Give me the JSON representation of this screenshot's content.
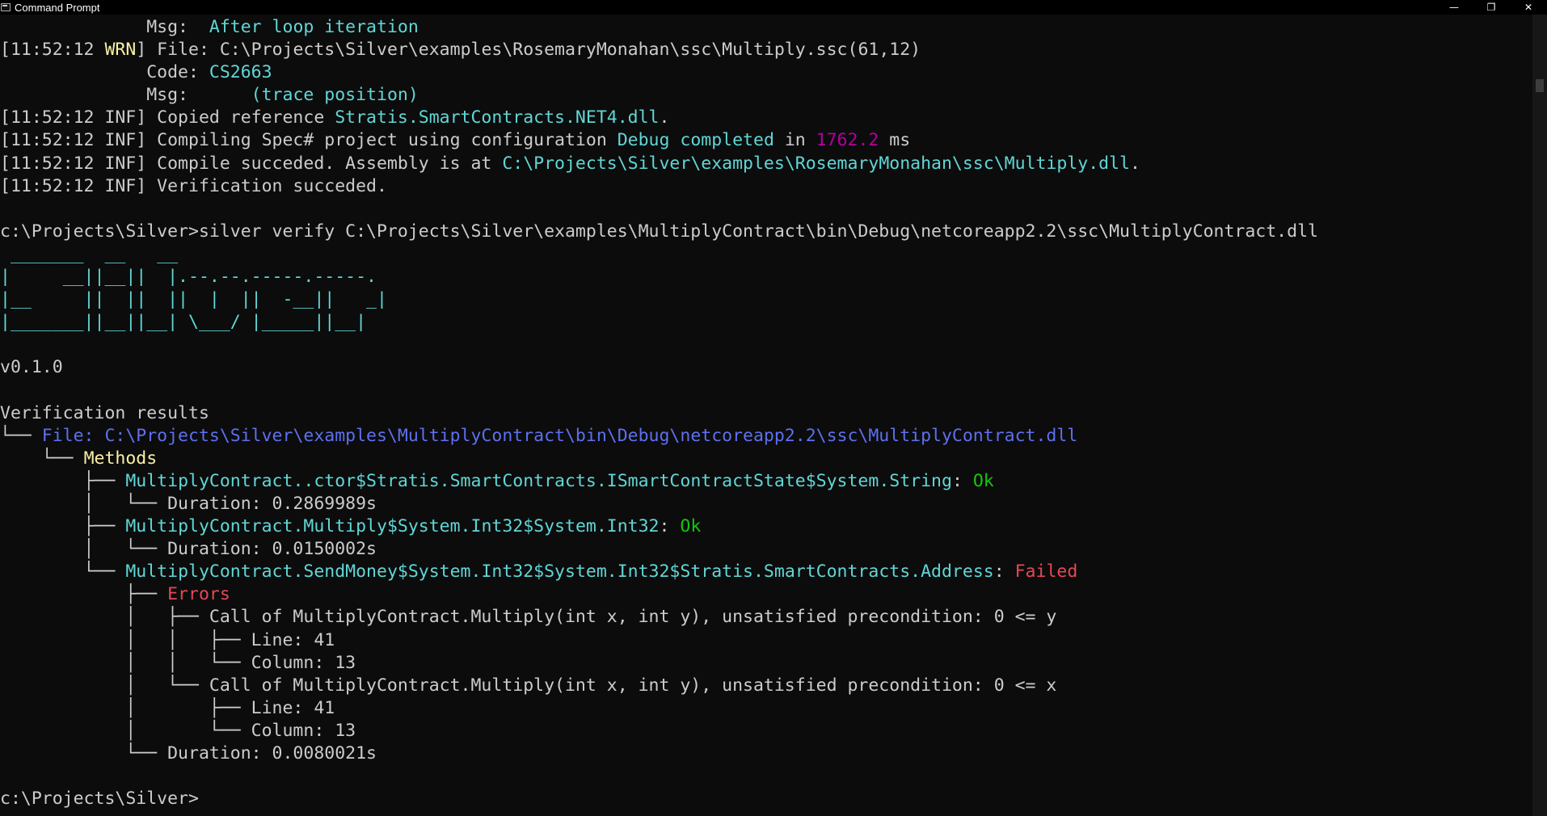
{
  "window": {
    "title": "Command Prompt",
    "minimize_glyph": "—",
    "maximize_glyph": "❐",
    "close_glyph": "✕"
  },
  "colors": {
    "background": "#0c0c0c",
    "text": "#cccccc",
    "cyan": "#61d6d6",
    "yellow": "#f9f1a5",
    "magenta": "#b4009e",
    "blue": "#5d70f0",
    "green": "#16c60c",
    "red": "#e74856"
  },
  "lines": [
    [
      [
        "c-white",
        "              Msg:  "
      ],
      [
        "c-cyan",
        "After loop iteration"
      ]
    ],
    [
      [
        "c-white",
        "[11:52:12 "
      ],
      [
        "c-warn",
        "WRN"
      ],
      [
        "c-white",
        "] File: C:\\Projects\\Silver\\examples\\RosemaryMonahan\\ssc\\Multiply.ssc(61,12)"
      ]
    ],
    [
      [
        "c-white",
        "              Code: "
      ],
      [
        "c-cyan",
        "CS2663"
      ]
    ],
    [
      [
        "c-white",
        "              Msg:      "
      ],
      [
        "c-cyan",
        "(trace position)"
      ]
    ],
    [
      [
        "c-white",
        "[11:52:12 INF] Copied reference "
      ],
      [
        "c-cyan",
        "Stratis.SmartContracts.NET4.dll"
      ],
      [
        "c-white",
        "."
      ]
    ],
    [
      [
        "c-white",
        "[11:52:12 INF] Compiling Spec# project using configuration "
      ],
      [
        "c-cyan",
        "Debug"
      ],
      [
        "c-white",
        " "
      ],
      [
        "c-cyan",
        "completed"
      ],
      [
        "c-white",
        " in "
      ],
      [
        "c-mag",
        "1762.2"
      ],
      [
        "c-white",
        " ms"
      ]
    ],
    [
      [
        "c-white",
        "[11:52:12 INF] Compile succeded. Assembly is at "
      ],
      [
        "c-cyan",
        "C:\\Projects\\Silver\\examples\\RosemaryMonahan\\ssc\\Multiply.dll"
      ],
      [
        "c-white",
        "."
      ]
    ],
    [
      [
        "c-white",
        "[11:52:12 INF] Verification succeded."
      ]
    ],
    [
      [
        "c-white",
        ""
      ]
    ],
    [
      [
        "c-white",
        "c:\\Projects\\Silver>silver verify C:\\Projects\\Silver\\examples\\MultiplyContract\\bin\\Debug\\netcoreapp2.2\\ssc\\MultiplyContract.dll"
      ]
    ],
    [
      [
        "c-cyan",
        " _______  __   __"
      ]
    ],
    [
      [
        "c-cyan",
        "|     __||__||  |.--.--.-----.-----."
      ]
    ],
    [
      [
        "c-cyan",
        "|__     ||  ||  ||  |  ||  -__||   _|"
      ]
    ],
    [
      [
        "c-cyan",
        "|_______||__||__| \\___/ |_____||__|"
      ]
    ],
    [
      [
        "c-white",
        ""
      ]
    ],
    [
      [
        "c-white",
        "v0.1.0"
      ]
    ],
    [
      [
        "c-white",
        ""
      ]
    ],
    [
      [
        "c-white",
        "Verification results"
      ]
    ],
    [
      [
        "c-white",
        "└── "
      ],
      [
        "c-blue",
        "File: C:\\Projects\\Silver\\examples\\MultiplyContract\\bin\\Debug\\netcoreapp2.2\\ssc\\MultiplyContract.dll"
      ]
    ],
    [
      [
        "c-white",
        "    └── "
      ],
      [
        "c-yel",
        "Methods"
      ]
    ],
    [
      [
        "c-white",
        "        ├── "
      ],
      [
        "c-cyan",
        "MultiplyContract..ctor$Stratis.SmartContracts.ISmartContractState$System.String"
      ],
      [
        "c-white",
        ": "
      ],
      [
        "c-green",
        "Ok"
      ]
    ],
    [
      [
        "c-white",
        "        │   └── Duration: 0.2869989s"
      ]
    ],
    [
      [
        "c-white",
        "        ├── "
      ],
      [
        "c-cyan",
        "MultiplyContract.Multiply$System.Int32$System.Int32"
      ],
      [
        "c-white",
        ": "
      ],
      [
        "c-green",
        "Ok"
      ]
    ],
    [
      [
        "c-white",
        "        │   └── Duration: 0.0150002s"
      ]
    ],
    [
      [
        "c-white",
        "        └── "
      ],
      [
        "c-cyan",
        "MultiplyContract.SendMoney$System.Int32$System.Int32$Stratis.SmartContracts.Address"
      ],
      [
        "c-white",
        ": "
      ],
      [
        "c-red",
        "Failed"
      ]
    ],
    [
      [
        "c-white",
        "            ├── "
      ],
      [
        "c-red",
        "Errors"
      ]
    ],
    [
      [
        "c-white",
        "            │   ├── Call of MultiplyContract.Multiply(int x, int y), unsatisfied precondition: 0 <= y"
      ]
    ],
    [
      [
        "c-white",
        "            │   │   ├── Line: 41"
      ]
    ],
    [
      [
        "c-white",
        "            │   │   └── Column: 13"
      ]
    ],
    [
      [
        "c-white",
        "            │   └── Call of MultiplyContract.Multiply(int x, int y), unsatisfied precondition: 0 <= x"
      ]
    ],
    [
      [
        "c-white",
        "            │       ├── Line: 41"
      ]
    ],
    [
      [
        "c-white",
        "            │       └── Column: 13"
      ]
    ],
    [
      [
        "c-white",
        "            └── Duration: 0.0080021s"
      ]
    ],
    [
      [
        "c-white",
        ""
      ]
    ],
    [
      [
        "c-white",
        "c:\\Projects\\Silver>"
      ]
    ]
  ]
}
